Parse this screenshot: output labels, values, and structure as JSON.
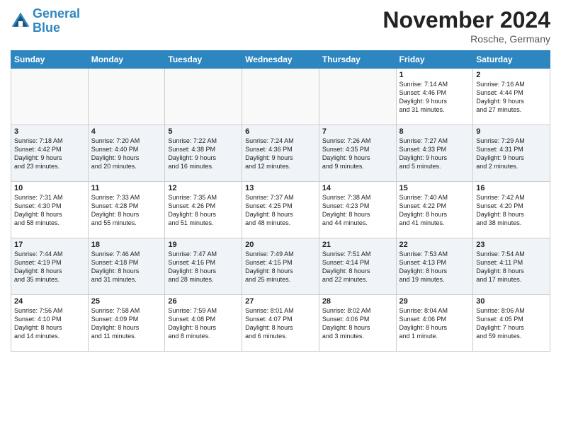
{
  "header": {
    "logo_line1": "General",
    "logo_line2": "Blue",
    "month": "November 2024",
    "location": "Rosche, Germany"
  },
  "days_of_week": [
    "Sunday",
    "Monday",
    "Tuesday",
    "Wednesday",
    "Thursday",
    "Friday",
    "Saturday"
  ],
  "weeks": [
    [
      {
        "day": "",
        "info": ""
      },
      {
        "day": "",
        "info": ""
      },
      {
        "day": "",
        "info": ""
      },
      {
        "day": "",
        "info": ""
      },
      {
        "day": "",
        "info": ""
      },
      {
        "day": "1",
        "info": "Sunrise: 7:14 AM\nSunset: 4:46 PM\nDaylight: 9 hours\nand 31 minutes."
      },
      {
        "day": "2",
        "info": "Sunrise: 7:16 AM\nSunset: 4:44 PM\nDaylight: 9 hours\nand 27 minutes."
      }
    ],
    [
      {
        "day": "3",
        "info": "Sunrise: 7:18 AM\nSunset: 4:42 PM\nDaylight: 9 hours\nand 23 minutes."
      },
      {
        "day": "4",
        "info": "Sunrise: 7:20 AM\nSunset: 4:40 PM\nDaylight: 9 hours\nand 20 minutes."
      },
      {
        "day": "5",
        "info": "Sunrise: 7:22 AM\nSunset: 4:38 PM\nDaylight: 9 hours\nand 16 minutes."
      },
      {
        "day": "6",
        "info": "Sunrise: 7:24 AM\nSunset: 4:36 PM\nDaylight: 9 hours\nand 12 minutes."
      },
      {
        "day": "7",
        "info": "Sunrise: 7:26 AM\nSunset: 4:35 PM\nDaylight: 9 hours\nand 9 minutes."
      },
      {
        "day": "8",
        "info": "Sunrise: 7:27 AM\nSunset: 4:33 PM\nDaylight: 9 hours\nand 5 minutes."
      },
      {
        "day": "9",
        "info": "Sunrise: 7:29 AM\nSunset: 4:31 PM\nDaylight: 9 hours\nand 2 minutes."
      }
    ],
    [
      {
        "day": "10",
        "info": "Sunrise: 7:31 AM\nSunset: 4:30 PM\nDaylight: 8 hours\nand 58 minutes."
      },
      {
        "day": "11",
        "info": "Sunrise: 7:33 AM\nSunset: 4:28 PM\nDaylight: 8 hours\nand 55 minutes."
      },
      {
        "day": "12",
        "info": "Sunrise: 7:35 AM\nSunset: 4:26 PM\nDaylight: 8 hours\nand 51 minutes."
      },
      {
        "day": "13",
        "info": "Sunrise: 7:37 AM\nSunset: 4:25 PM\nDaylight: 8 hours\nand 48 minutes."
      },
      {
        "day": "14",
        "info": "Sunrise: 7:38 AM\nSunset: 4:23 PM\nDaylight: 8 hours\nand 44 minutes."
      },
      {
        "day": "15",
        "info": "Sunrise: 7:40 AM\nSunset: 4:22 PM\nDaylight: 8 hours\nand 41 minutes."
      },
      {
        "day": "16",
        "info": "Sunrise: 7:42 AM\nSunset: 4:20 PM\nDaylight: 8 hours\nand 38 minutes."
      }
    ],
    [
      {
        "day": "17",
        "info": "Sunrise: 7:44 AM\nSunset: 4:19 PM\nDaylight: 8 hours\nand 35 minutes."
      },
      {
        "day": "18",
        "info": "Sunrise: 7:46 AM\nSunset: 4:18 PM\nDaylight: 8 hours\nand 31 minutes."
      },
      {
        "day": "19",
        "info": "Sunrise: 7:47 AM\nSunset: 4:16 PM\nDaylight: 8 hours\nand 28 minutes."
      },
      {
        "day": "20",
        "info": "Sunrise: 7:49 AM\nSunset: 4:15 PM\nDaylight: 8 hours\nand 25 minutes."
      },
      {
        "day": "21",
        "info": "Sunrise: 7:51 AM\nSunset: 4:14 PM\nDaylight: 8 hours\nand 22 minutes."
      },
      {
        "day": "22",
        "info": "Sunrise: 7:53 AM\nSunset: 4:13 PM\nDaylight: 8 hours\nand 19 minutes."
      },
      {
        "day": "23",
        "info": "Sunrise: 7:54 AM\nSunset: 4:11 PM\nDaylight: 8 hours\nand 17 minutes."
      }
    ],
    [
      {
        "day": "24",
        "info": "Sunrise: 7:56 AM\nSunset: 4:10 PM\nDaylight: 8 hours\nand 14 minutes."
      },
      {
        "day": "25",
        "info": "Sunrise: 7:58 AM\nSunset: 4:09 PM\nDaylight: 8 hours\nand 11 minutes."
      },
      {
        "day": "26",
        "info": "Sunrise: 7:59 AM\nSunset: 4:08 PM\nDaylight: 8 hours\nand 8 minutes."
      },
      {
        "day": "27",
        "info": "Sunrise: 8:01 AM\nSunset: 4:07 PM\nDaylight: 8 hours\nand 6 minutes."
      },
      {
        "day": "28",
        "info": "Sunrise: 8:02 AM\nSunset: 4:06 PM\nDaylight: 8 hours\nand 3 minutes."
      },
      {
        "day": "29",
        "info": "Sunrise: 8:04 AM\nSunset: 4:06 PM\nDaylight: 8 hours\nand 1 minute."
      },
      {
        "day": "30",
        "info": "Sunrise: 8:06 AM\nSunset: 4:05 PM\nDaylight: 7 hours\nand 59 minutes."
      }
    ]
  ]
}
